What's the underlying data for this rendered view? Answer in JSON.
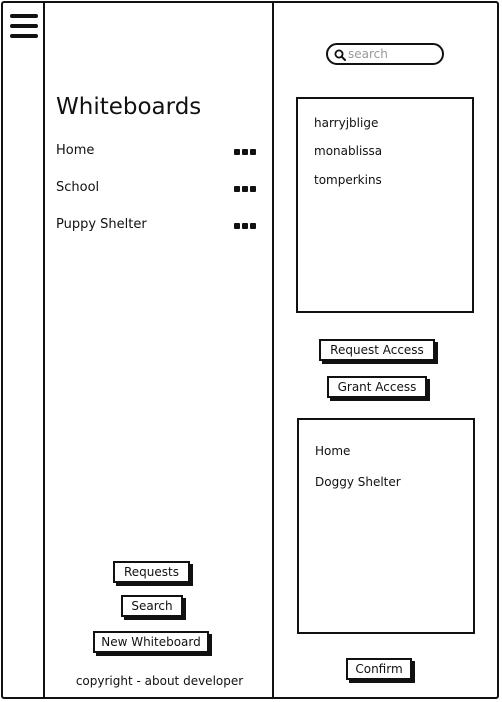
{
  "sidebar": {
    "title": "Whiteboards",
    "boards": [
      {
        "label": "Home"
      },
      {
        "label": "School"
      },
      {
        "label": "Puppy Shelter"
      }
    ],
    "buttons": {
      "requests": "Requests",
      "search": "Search",
      "new_whiteboard": "New Whiteboard"
    },
    "footer": "copyright - about developer"
  },
  "right": {
    "search": {
      "placeholder": "search",
      "value": ""
    },
    "users": [
      "harryjblige",
      "monablissa",
      "tomperkins"
    ],
    "buttons": {
      "request_access": "Request Access",
      "grant_access": "Grant Access",
      "confirm": "Confirm"
    },
    "shared_boards": [
      "Home",
      "Doggy Shelter"
    ]
  },
  "icons": {
    "menu": "hamburger-menu-icon",
    "more": "ellipsis-icon",
    "search": "search-icon"
  }
}
